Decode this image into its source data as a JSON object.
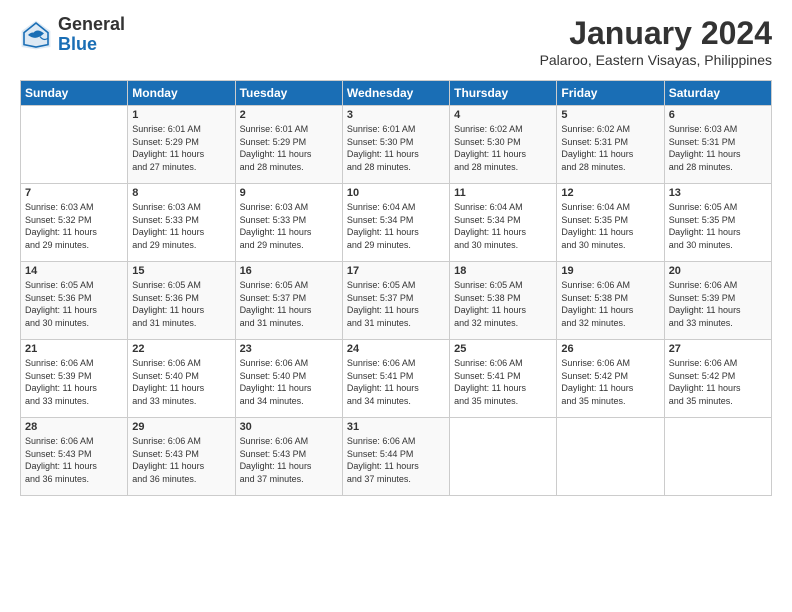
{
  "logo": {
    "general": "General",
    "blue": "Blue"
  },
  "title": "January 2024",
  "location": "Palaroo, Eastern Visayas, Philippines",
  "days_of_week": [
    "Sunday",
    "Monday",
    "Tuesday",
    "Wednesday",
    "Thursday",
    "Friday",
    "Saturday"
  ],
  "weeks": [
    [
      {
        "num": "",
        "info": ""
      },
      {
        "num": "1",
        "info": "Sunrise: 6:01 AM\nSunset: 5:29 PM\nDaylight: 11 hours\nand 27 minutes."
      },
      {
        "num": "2",
        "info": "Sunrise: 6:01 AM\nSunset: 5:29 PM\nDaylight: 11 hours\nand 28 minutes."
      },
      {
        "num": "3",
        "info": "Sunrise: 6:01 AM\nSunset: 5:30 PM\nDaylight: 11 hours\nand 28 minutes."
      },
      {
        "num": "4",
        "info": "Sunrise: 6:02 AM\nSunset: 5:30 PM\nDaylight: 11 hours\nand 28 minutes."
      },
      {
        "num": "5",
        "info": "Sunrise: 6:02 AM\nSunset: 5:31 PM\nDaylight: 11 hours\nand 28 minutes."
      },
      {
        "num": "6",
        "info": "Sunrise: 6:03 AM\nSunset: 5:31 PM\nDaylight: 11 hours\nand 28 minutes."
      }
    ],
    [
      {
        "num": "7",
        "info": "Sunrise: 6:03 AM\nSunset: 5:32 PM\nDaylight: 11 hours\nand 29 minutes."
      },
      {
        "num": "8",
        "info": "Sunrise: 6:03 AM\nSunset: 5:33 PM\nDaylight: 11 hours\nand 29 minutes."
      },
      {
        "num": "9",
        "info": "Sunrise: 6:03 AM\nSunset: 5:33 PM\nDaylight: 11 hours\nand 29 minutes."
      },
      {
        "num": "10",
        "info": "Sunrise: 6:04 AM\nSunset: 5:34 PM\nDaylight: 11 hours\nand 29 minutes."
      },
      {
        "num": "11",
        "info": "Sunrise: 6:04 AM\nSunset: 5:34 PM\nDaylight: 11 hours\nand 30 minutes."
      },
      {
        "num": "12",
        "info": "Sunrise: 6:04 AM\nSunset: 5:35 PM\nDaylight: 11 hours\nand 30 minutes."
      },
      {
        "num": "13",
        "info": "Sunrise: 6:05 AM\nSunset: 5:35 PM\nDaylight: 11 hours\nand 30 minutes."
      }
    ],
    [
      {
        "num": "14",
        "info": "Sunrise: 6:05 AM\nSunset: 5:36 PM\nDaylight: 11 hours\nand 30 minutes."
      },
      {
        "num": "15",
        "info": "Sunrise: 6:05 AM\nSunset: 5:36 PM\nDaylight: 11 hours\nand 31 minutes."
      },
      {
        "num": "16",
        "info": "Sunrise: 6:05 AM\nSunset: 5:37 PM\nDaylight: 11 hours\nand 31 minutes."
      },
      {
        "num": "17",
        "info": "Sunrise: 6:05 AM\nSunset: 5:37 PM\nDaylight: 11 hours\nand 31 minutes."
      },
      {
        "num": "18",
        "info": "Sunrise: 6:05 AM\nSunset: 5:38 PM\nDaylight: 11 hours\nand 32 minutes."
      },
      {
        "num": "19",
        "info": "Sunrise: 6:06 AM\nSunset: 5:38 PM\nDaylight: 11 hours\nand 32 minutes."
      },
      {
        "num": "20",
        "info": "Sunrise: 6:06 AM\nSunset: 5:39 PM\nDaylight: 11 hours\nand 33 minutes."
      }
    ],
    [
      {
        "num": "21",
        "info": "Sunrise: 6:06 AM\nSunset: 5:39 PM\nDaylight: 11 hours\nand 33 minutes."
      },
      {
        "num": "22",
        "info": "Sunrise: 6:06 AM\nSunset: 5:40 PM\nDaylight: 11 hours\nand 33 minutes."
      },
      {
        "num": "23",
        "info": "Sunrise: 6:06 AM\nSunset: 5:40 PM\nDaylight: 11 hours\nand 34 minutes."
      },
      {
        "num": "24",
        "info": "Sunrise: 6:06 AM\nSunset: 5:41 PM\nDaylight: 11 hours\nand 34 minutes."
      },
      {
        "num": "25",
        "info": "Sunrise: 6:06 AM\nSunset: 5:41 PM\nDaylight: 11 hours\nand 35 minutes."
      },
      {
        "num": "26",
        "info": "Sunrise: 6:06 AM\nSunset: 5:42 PM\nDaylight: 11 hours\nand 35 minutes."
      },
      {
        "num": "27",
        "info": "Sunrise: 6:06 AM\nSunset: 5:42 PM\nDaylight: 11 hours\nand 35 minutes."
      }
    ],
    [
      {
        "num": "28",
        "info": "Sunrise: 6:06 AM\nSunset: 5:43 PM\nDaylight: 11 hours\nand 36 minutes."
      },
      {
        "num": "29",
        "info": "Sunrise: 6:06 AM\nSunset: 5:43 PM\nDaylight: 11 hours\nand 36 minutes."
      },
      {
        "num": "30",
        "info": "Sunrise: 6:06 AM\nSunset: 5:43 PM\nDaylight: 11 hours\nand 37 minutes."
      },
      {
        "num": "31",
        "info": "Sunrise: 6:06 AM\nSunset: 5:44 PM\nDaylight: 11 hours\nand 37 minutes."
      },
      {
        "num": "",
        "info": ""
      },
      {
        "num": "",
        "info": ""
      },
      {
        "num": "",
        "info": ""
      }
    ]
  ]
}
